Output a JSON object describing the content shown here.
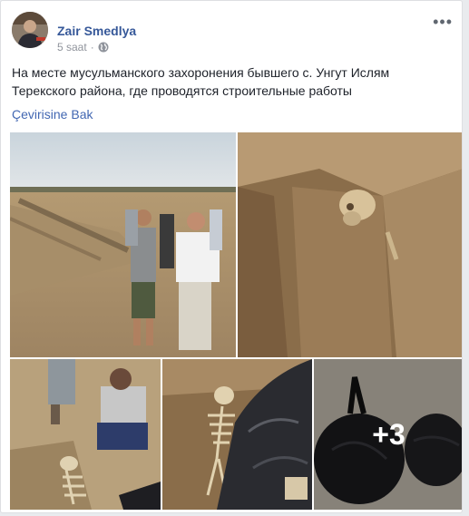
{
  "post": {
    "author": "Zair Smedlya",
    "time": "5 saat",
    "separator": "·",
    "privacy_icon": "globe-icon",
    "options_icon": "more-options-icon",
    "text": "На месте мусульманского захоронения бывшего с. Унгут Ислям Терекского района, где проводятся строительные работы",
    "translate_link": "Çevirisine Bak"
  },
  "photos": {
    "more_count": "+3"
  },
  "colors": {
    "link": "#365899",
    "translate": "#4267b2",
    "meta": "#90949c",
    "text": "#1d2129"
  }
}
